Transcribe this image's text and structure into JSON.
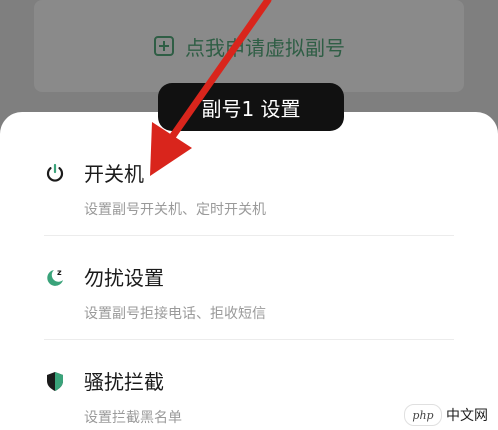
{
  "background": {
    "apply_button_label": "点我申请虚拟副号"
  },
  "sheet": {
    "title": "副号1 设置",
    "items": [
      {
        "icon": "power-icon",
        "label": "开关机",
        "description": "设置副号开关机、定时开关机"
      },
      {
        "icon": "moon-zz-icon",
        "label": "勿扰设置",
        "description": "设置副号拒接电话、拒收短信"
      },
      {
        "icon": "shield-icon",
        "label": "骚扰拦截",
        "description": "设置拦截黑名单"
      }
    ]
  },
  "watermark": {
    "logo_text": "php",
    "site_text": "中文网"
  },
  "colors": {
    "accent_green": "#3aa37a",
    "arrow_red": "#d9251c",
    "sheet_bg": "#ffffff",
    "overlay": "#7f7f7f"
  }
}
